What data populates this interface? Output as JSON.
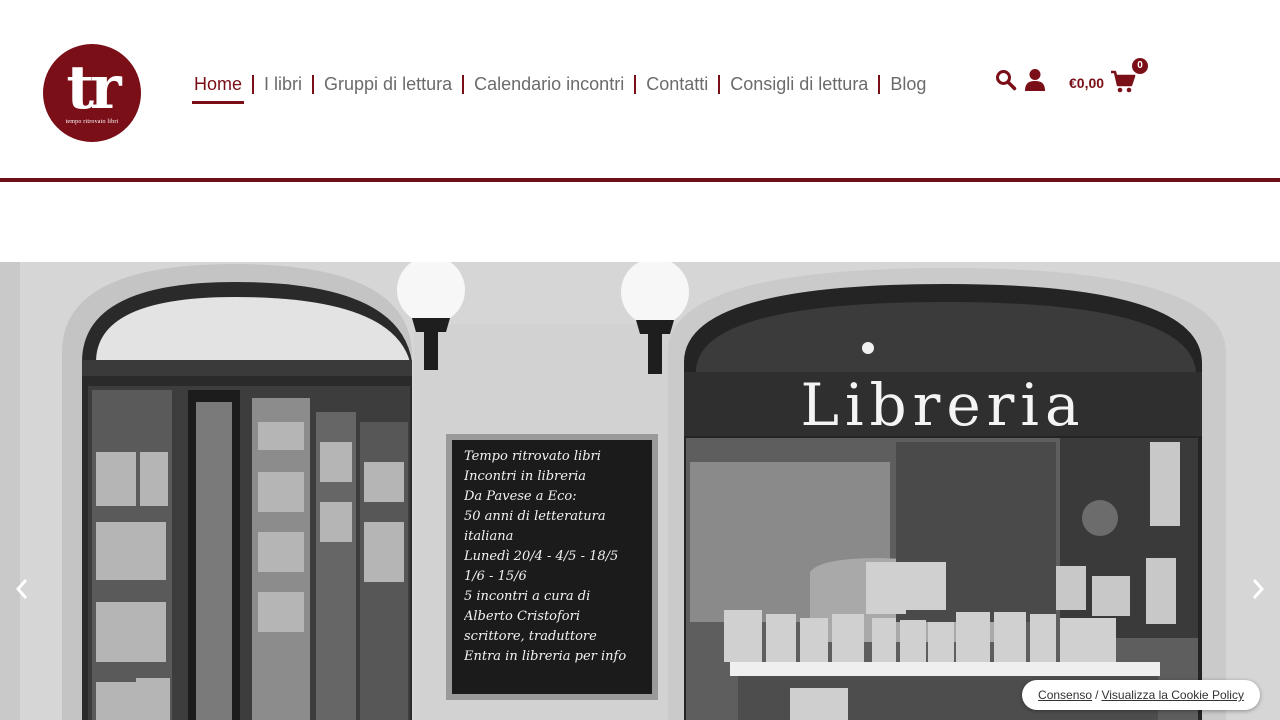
{
  "brand": {
    "logo_mark": "tr",
    "logo_tagline": "tempo ritrovato libri",
    "color": "#7a0f18"
  },
  "nav": {
    "items": [
      {
        "label": "Home",
        "active": true
      },
      {
        "label": "I libri",
        "active": false
      },
      {
        "label": "Gruppi di lettura",
        "active": false
      },
      {
        "label": "Calendario incontri",
        "active": false
      },
      {
        "label": "Contatti",
        "active": false
      },
      {
        "label": "Consigli di lettura",
        "active": false
      },
      {
        "label": "Blog",
        "active": false
      }
    ]
  },
  "header_tools": {
    "search_icon": "search-icon",
    "account_icon": "user-icon",
    "cart_total": "€0,00",
    "cart_icon": "cart-icon",
    "cart_count": "0"
  },
  "hero": {
    "sign_text": "Libreria",
    "chalkboard_lines": [
      "Tempo ritrovato libri",
      "Incontri in libreria",
      "Da Pavese a Eco:",
      "50 anni di letteratura",
      "italiana",
      "Lunedì 20/4 - 4/5 - 18/5",
      "1/6 - 15/6",
      "5 incontri a cura di",
      "Alberto Cristofori",
      "scrittore, traduttore",
      "Entra in libreria per info"
    ],
    "prev_icon": "chevron-left-icon",
    "next_icon": "chevron-right-icon"
  },
  "cookie": {
    "consent_label": "Consenso",
    "separator": "/",
    "policy_label": "Visualizza la Cookie Policy"
  }
}
